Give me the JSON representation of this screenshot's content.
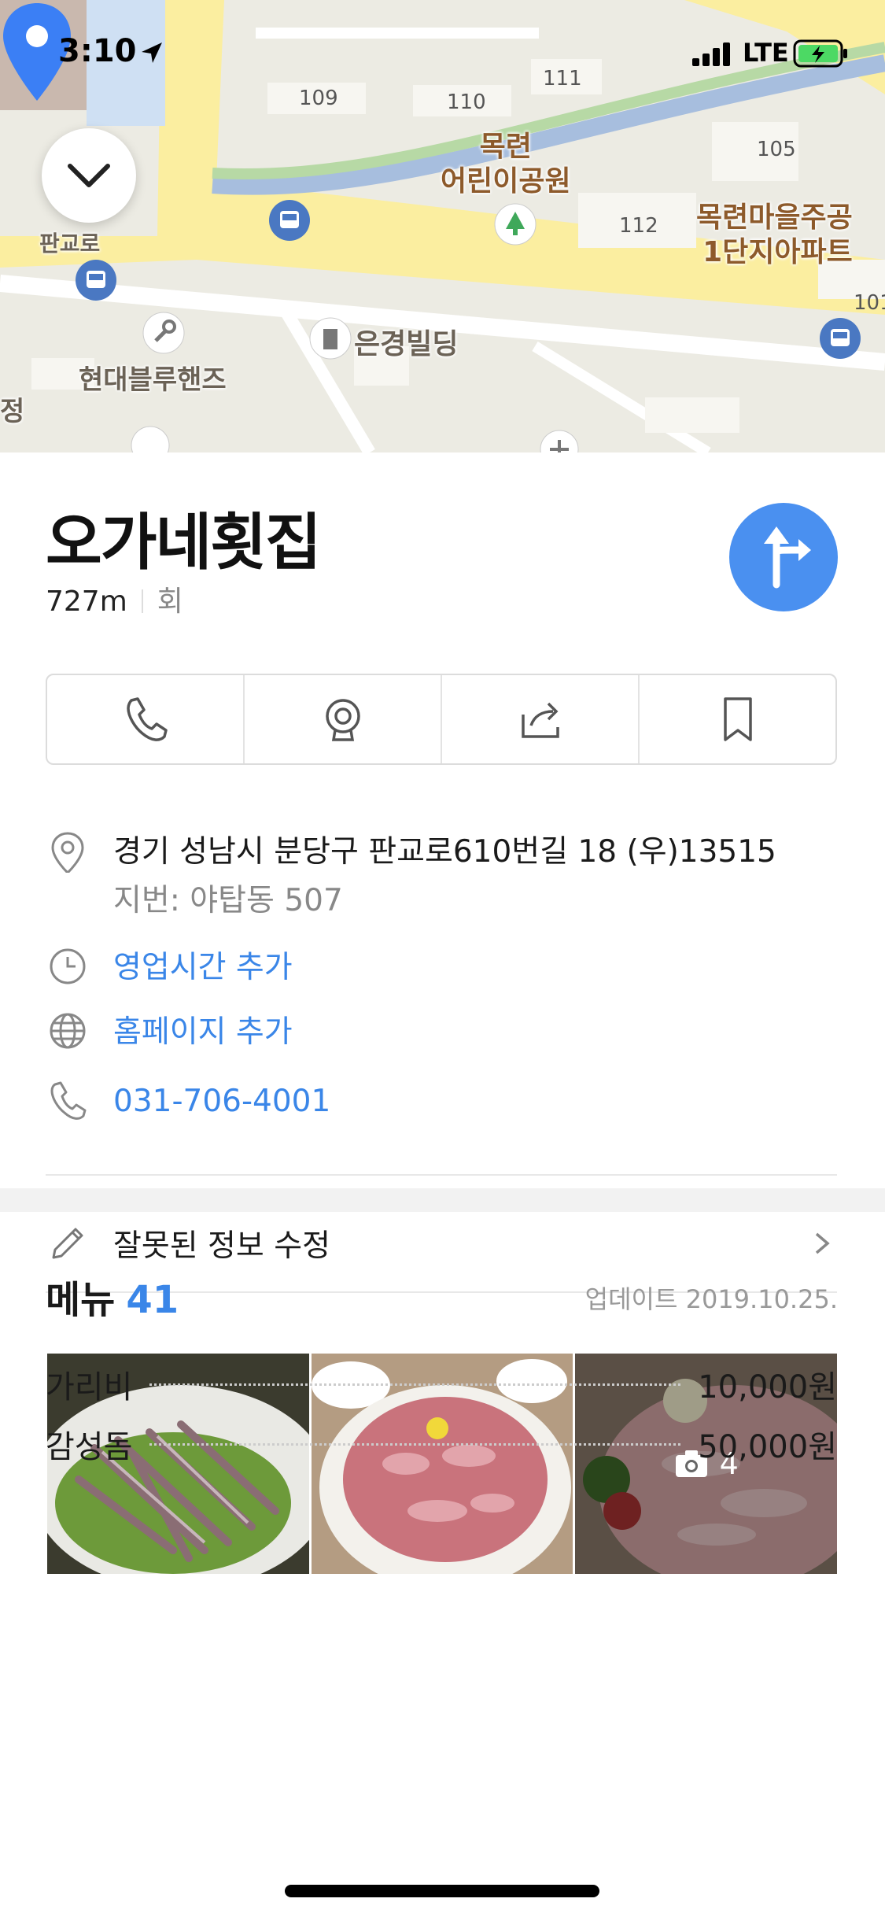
{
  "status_bar": {
    "time": "3:10",
    "carrier": "LTE"
  },
  "map": {
    "labels": {
      "park": "목련\n어린이공원",
      "apartment": "목련마을주공\n1단지아파트",
      "road": "판교로",
      "hyundai": "현대블루핸즈",
      "eungyeong": "은경빌딩",
      "jeong": "정"
    },
    "building_numbers": [
      "109",
      "110",
      "111",
      "105",
      "112",
      "101"
    ]
  },
  "place": {
    "name": "오가네횟집",
    "distance": "727m",
    "category": "회"
  },
  "actions": [
    "call-icon",
    "street-view-icon",
    "share-icon",
    "bookmark-icon"
  ],
  "info": {
    "address": "경기 성남시 분당구 판교로610번길 18 (우)13515",
    "jibun": "지번: 야탑동 507",
    "hours_link": "영업시간 추가",
    "homepage_link": "홈페이지 추가",
    "phone": "031-706-4001"
  },
  "edit": {
    "label": "잘못된 정보 수정"
  },
  "photos": {
    "count": "4"
  },
  "menu": {
    "title": "메뉴",
    "count": "41",
    "updated": "업데이트 2019.10.25.",
    "items": [
      {
        "name": "가리비",
        "price": "10,000원"
      },
      {
        "name": "감성돔",
        "price": "50,000원"
      }
    ]
  },
  "colors": {
    "accent": "#3a86e8",
    "route_button": "#4a90f0",
    "pin": "#3b7ff5"
  }
}
